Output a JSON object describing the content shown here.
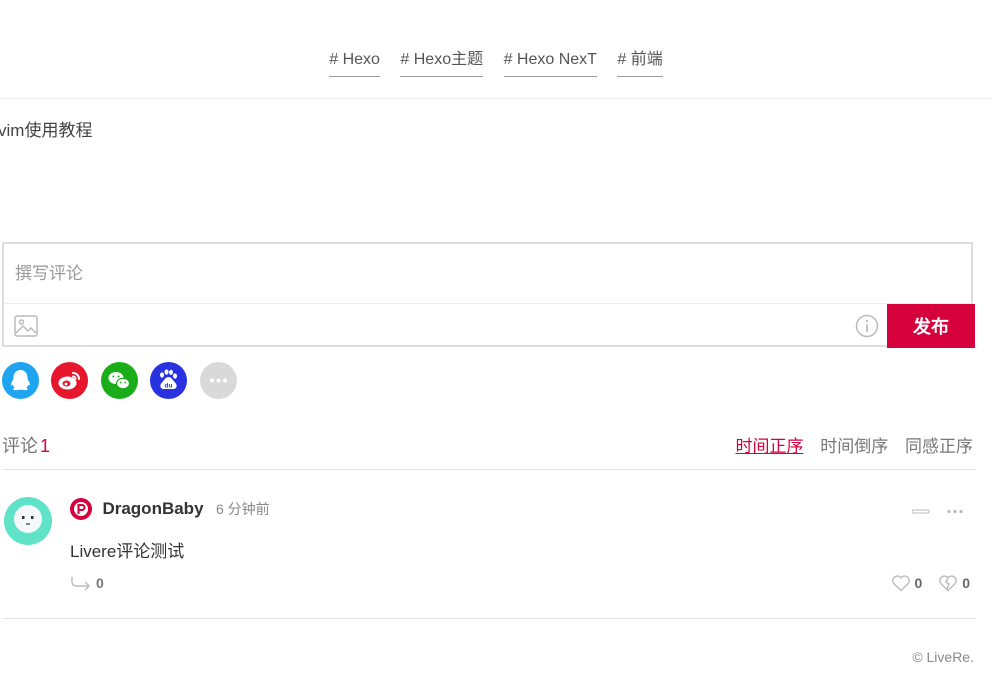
{
  "tags": [
    "# Hexo",
    "# Hexo主题",
    "# Hexo NexT",
    "# 前端"
  ],
  "post_link": "vim使用教程",
  "editor": {
    "placeholder": "撰写评论",
    "submit_label": "发布",
    "accent": "#d6003d"
  },
  "social_logins": [
    {
      "icon": "qq-icon",
      "color": "#1fa4f2"
    },
    {
      "icon": "weibo-icon",
      "color": "#e6162d"
    },
    {
      "icon": "wechat-icon",
      "color": "#1aad19"
    },
    {
      "icon": "baidu-icon",
      "color": "#2932e1"
    },
    {
      "icon": "more-icon",
      "color": "#d9d9d9"
    }
  ],
  "comments_header": {
    "label": "评论",
    "count": "1",
    "sort_options": [
      "时间正序",
      "时间倒序",
      "同感正序"
    ],
    "active_sort": "时间正序"
  },
  "comments": [
    {
      "author": "DragonBaby",
      "time": "6 分钟前",
      "text": "Livere评论测试",
      "replies": "0",
      "likes": "0",
      "dislikes": "0"
    }
  ],
  "brand": "© LiveRe."
}
